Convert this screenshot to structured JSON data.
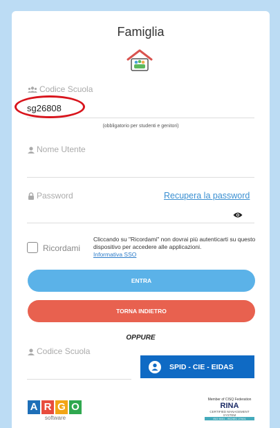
{
  "header": {
    "title": "Famiglia",
    "family_icon": "family-home-icon"
  },
  "school_code": {
    "label": "Codice Scuola",
    "value": "sg26808",
    "hint": "(obbligatorio per studenti e genitori)"
  },
  "username": {
    "label": "Nome Utente"
  },
  "password": {
    "label": "Password",
    "recover_link": "Recupera la password"
  },
  "remember": {
    "label": "Ricordami",
    "info": "Cliccando su \"Ricordami\" non dovrai più autenticarti su questo dispositivo per accedere alle applicazioni.",
    "info_link": "Informativa SSO"
  },
  "buttons": {
    "enter": "ENTRA",
    "back": "TORNA INDIETRO"
  },
  "divider": "OPPURE",
  "alt_login": {
    "school_code_label": "Codice Scuola",
    "spid_button": "SPID - CIE - EIDAS"
  },
  "footer": {
    "argo_letters": [
      "A",
      "R",
      "G",
      "O"
    ],
    "argo_colors": [
      "#1e6fb8",
      "#e84c3d",
      "#f2a516",
      "#2fa84f"
    ],
    "argo_sub": "software",
    "rina_top": "Member of CISQ Federation",
    "rina_logo": "RINA",
    "rina_sub": "CERTIFIED MANAGEMENT SYSTEM",
    "rina_iso": "ISO 9001 - ISO/IEC 27001"
  },
  "colors": {
    "enter": "#5bb2e8",
    "back": "#e8614f",
    "spid": "#0f6ac4",
    "annotation": "#d8141c"
  }
}
